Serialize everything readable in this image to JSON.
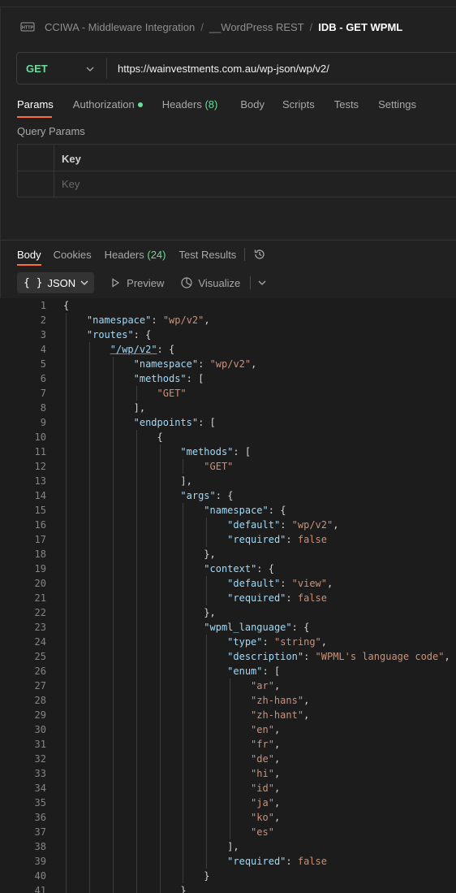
{
  "breadcrumb": {
    "items": [
      "CCIWA - Middleware Integration",
      "__WordPress REST"
    ],
    "separator": "/",
    "current": "IDB - GET WPML"
  },
  "request": {
    "method": "GET",
    "url": "https://wainvestments.com.au/wp-json/wp/v2/"
  },
  "request_tabs": [
    {
      "label": "Params"
    },
    {
      "label": "Authorization"
    },
    {
      "label": "Headers",
      "count": "(8)"
    },
    {
      "label": "Body"
    },
    {
      "label": "Scripts"
    },
    {
      "label": "Tests"
    },
    {
      "label": "Settings"
    }
  ],
  "query_params": {
    "title": "Query Params",
    "key_header": "Key",
    "key_placeholder": "Key"
  },
  "response_tabs": [
    {
      "label": "Body"
    },
    {
      "label": "Cookies"
    },
    {
      "label": "Headers",
      "count": "(24)"
    },
    {
      "label": "Test Results"
    }
  ],
  "toolbar": {
    "format_icon": "{ }",
    "format": "JSON",
    "preview": "Preview",
    "visualize": "Visualize"
  },
  "colors": {
    "accent": "#ff6c37",
    "method_get": "#6bdd9a",
    "key": "#9cdcfe",
    "string": "#ce9178",
    "boolean": "#cf8e6d"
  },
  "code": [
    {
      "n": "1",
      "ind": 0,
      "t": [
        {
          "c": "p",
          "v": "{"
        }
      ]
    },
    {
      "n": "2",
      "ind": 1,
      "t": [
        {
          "c": "k",
          "v": "\"namespace\""
        },
        {
          "c": "p",
          "v": ": "
        },
        {
          "c": "s",
          "v": "\"wp/v2\""
        },
        {
          "c": "p",
          "v": ","
        }
      ]
    },
    {
      "n": "3",
      "ind": 1,
      "t": [
        {
          "c": "k",
          "v": "\"routes\""
        },
        {
          "c": "p",
          "v": ": {"
        }
      ]
    },
    {
      "n": "4",
      "ind": 2,
      "t": [
        {
          "c": "ku",
          "v": "\"/wp/v2\""
        },
        {
          "c": "p",
          "v": ": {"
        }
      ]
    },
    {
      "n": "5",
      "ind": 3,
      "t": [
        {
          "c": "k",
          "v": "\"namespace\""
        },
        {
          "c": "p",
          "v": ": "
        },
        {
          "c": "s",
          "v": "\"wp/v2\""
        },
        {
          "c": "p",
          "v": ","
        }
      ]
    },
    {
      "n": "6",
      "ind": 3,
      "t": [
        {
          "c": "k",
          "v": "\"methods\""
        },
        {
          "c": "p",
          "v": ": ["
        }
      ]
    },
    {
      "n": "7",
      "ind": 4,
      "t": [
        {
          "c": "s",
          "v": "\"GET\""
        }
      ]
    },
    {
      "n": "8",
      "ind": 3,
      "t": [
        {
          "c": "p",
          "v": "],"
        }
      ]
    },
    {
      "n": "9",
      "ind": 3,
      "t": [
        {
          "c": "k",
          "v": "\"endpoints\""
        },
        {
          "c": "p",
          "v": ": ["
        }
      ]
    },
    {
      "n": "10",
      "ind": 4,
      "t": [
        {
          "c": "p",
          "v": "{"
        }
      ]
    },
    {
      "n": "11",
      "ind": 5,
      "t": [
        {
          "c": "k",
          "v": "\"methods\""
        },
        {
          "c": "p",
          "v": ": ["
        }
      ]
    },
    {
      "n": "12",
      "ind": 6,
      "t": [
        {
          "c": "s",
          "v": "\"GET\""
        }
      ]
    },
    {
      "n": "13",
      "ind": 5,
      "t": [
        {
          "c": "p",
          "v": "],"
        }
      ]
    },
    {
      "n": "14",
      "ind": 5,
      "t": [
        {
          "c": "k",
          "v": "\"args\""
        },
        {
          "c": "p",
          "v": ": {"
        }
      ]
    },
    {
      "n": "15",
      "ind": 6,
      "t": [
        {
          "c": "k",
          "v": "\"namespace\""
        },
        {
          "c": "p",
          "v": ": {"
        }
      ]
    },
    {
      "n": "16",
      "ind": 7,
      "t": [
        {
          "c": "k",
          "v": "\"default\""
        },
        {
          "c": "p",
          "v": ": "
        },
        {
          "c": "s",
          "v": "\"wp/v2\""
        },
        {
          "c": "p",
          "v": ","
        }
      ]
    },
    {
      "n": "17",
      "ind": 7,
      "t": [
        {
          "c": "k",
          "v": "\"required\""
        },
        {
          "c": "p",
          "v": ": "
        },
        {
          "c": "b",
          "v": "false"
        }
      ]
    },
    {
      "n": "18",
      "ind": 6,
      "t": [
        {
          "c": "p",
          "v": "},"
        }
      ]
    },
    {
      "n": "19",
      "ind": 6,
      "t": [
        {
          "c": "k",
          "v": "\"context\""
        },
        {
          "c": "p",
          "v": ": {"
        }
      ]
    },
    {
      "n": "20",
      "ind": 7,
      "t": [
        {
          "c": "k",
          "v": "\"default\""
        },
        {
          "c": "p",
          "v": ": "
        },
        {
          "c": "s",
          "v": "\"view\""
        },
        {
          "c": "p",
          "v": ","
        }
      ]
    },
    {
      "n": "21",
      "ind": 7,
      "t": [
        {
          "c": "k",
          "v": "\"required\""
        },
        {
          "c": "p",
          "v": ": "
        },
        {
          "c": "b",
          "v": "false"
        }
      ]
    },
    {
      "n": "22",
      "ind": 6,
      "t": [
        {
          "c": "p",
          "v": "},"
        }
      ]
    },
    {
      "n": "23",
      "ind": 6,
      "t": [
        {
          "c": "k",
          "v": "\"wpml_language\""
        },
        {
          "c": "p",
          "v": ": {"
        }
      ]
    },
    {
      "n": "24",
      "ind": 7,
      "t": [
        {
          "c": "k",
          "v": "\"type\""
        },
        {
          "c": "p",
          "v": ": "
        },
        {
          "c": "s",
          "v": "\"string\""
        },
        {
          "c": "p",
          "v": ","
        }
      ]
    },
    {
      "n": "25",
      "ind": 7,
      "t": [
        {
          "c": "k",
          "v": "\"description\""
        },
        {
          "c": "p",
          "v": ": "
        },
        {
          "c": "s",
          "v": "\"WPML's language code\""
        },
        {
          "c": "p",
          "v": ","
        }
      ]
    },
    {
      "n": "26",
      "ind": 7,
      "t": [
        {
          "c": "k",
          "v": "\"enum\""
        },
        {
          "c": "p",
          "v": ": ["
        }
      ]
    },
    {
      "n": "27",
      "ind": 8,
      "t": [
        {
          "c": "s",
          "v": "\"ar\""
        },
        {
          "c": "p",
          "v": ","
        }
      ]
    },
    {
      "n": "28",
      "ind": 8,
      "t": [
        {
          "c": "s",
          "v": "\"zh-hans\""
        },
        {
          "c": "p",
          "v": ","
        }
      ]
    },
    {
      "n": "29",
      "ind": 8,
      "t": [
        {
          "c": "s",
          "v": "\"zh-hant\""
        },
        {
          "c": "p",
          "v": ","
        }
      ]
    },
    {
      "n": "30",
      "ind": 8,
      "t": [
        {
          "c": "s",
          "v": "\"en\""
        },
        {
          "c": "p",
          "v": ","
        }
      ]
    },
    {
      "n": "31",
      "ind": 8,
      "t": [
        {
          "c": "s",
          "v": "\"fr\""
        },
        {
          "c": "p",
          "v": ","
        }
      ]
    },
    {
      "n": "32",
      "ind": 8,
      "t": [
        {
          "c": "s",
          "v": "\"de\""
        },
        {
          "c": "p",
          "v": ","
        }
      ]
    },
    {
      "n": "33",
      "ind": 8,
      "t": [
        {
          "c": "s",
          "v": "\"hi\""
        },
        {
          "c": "p",
          "v": ","
        }
      ]
    },
    {
      "n": "34",
      "ind": 8,
      "t": [
        {
          "c": "s",
          "v": "\"id\""
        },
        {
          "c": "p",
          "v": ","
        }
      ]
    },
    {
      "n": "35",
      "ind": 8,
      "t": [
        {
          "c": "s",
          "v": "\"ja\""
        },
        {
          "c": "p",
          "v": ","
        }
      ]
    },
    {
      "n": "36",
      "ind": 8,
      "t": [
        {
          "c": "s",
          "v": "\"ko\""
        },
        {
          "c": "p",
          "v": ","
        }
      ]
    },
    {
      "n": "37",
      "ind": 8,
      "t": [
        {
          "c": "s",
          "v": "\"es\""
        }
      ]
    },
    {
      "n": "38",
      "ind": 7,
      "t": [
        {
          "c": "p",
          "v": "],"
        }
      ]
    },
    {
      "n": "39",
      "ind": 7,
      "t": [
        {
          "c": "k",
          "v": "\"required\""
        },
        {
          "c": "p",
          "v": ": "
        },
        {
          "c": "b",
          "v": "false"
        }
      ]
    },
    {
      "n": "40",
      "ind": 6,
      "t": [
        {
          "c": "p",
          "v": "}"
        }
      ]
    },
    {
      "n": "41",
      "ind": 5,
      "t": [
        {
          "c": "p",
          "v": "}"
        }
      ]
    }
  ]
}
